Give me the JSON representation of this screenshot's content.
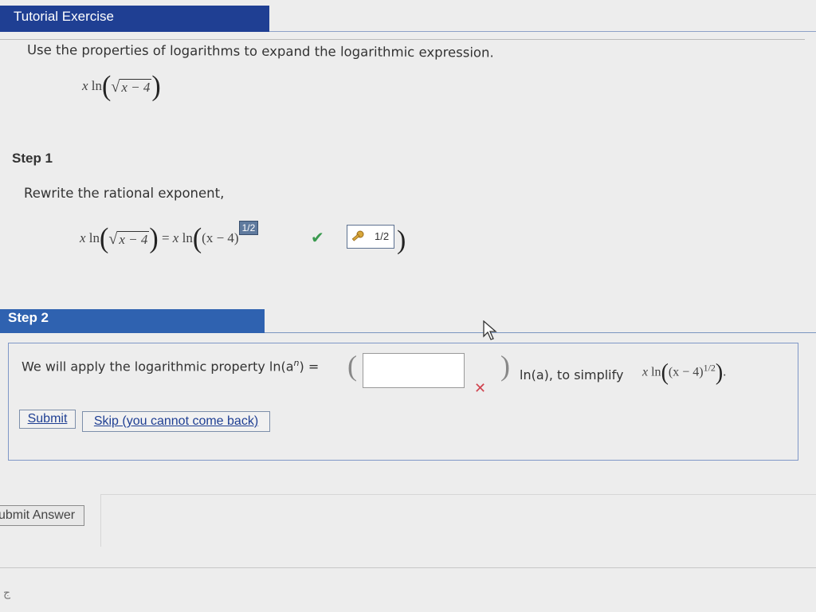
{
  "header": {
    "title": "Tutorial Exercise"
  },
  "problem": {
    "instruction": "Use the properties of logarithms to expand the logarithmic expression.",
    "expression": {
      "coef": "x",
      "fn": "ln",
      "radicand": "x − 4"
    }
  },
  "step1": {
    "label": "Step 1",
    "text": "Rewrite the rational exponent,",
    "lhs": {
      "coef": "x",
      "fn": "ln",
      "radicand": "x − 4"
    },
    "equals": "=",
    "rhs": {
      "coef": "x",
      "fn": "ln",
      "base": "(x − 4)",
      "exponent": "1/2"
    },
    "answer_value": "1/2",
    "status": "correct",
    "icons": {
      "check": "check-icon",
      "key": "key-icon"
    }
  },
  "step2": {
    "label": "Step 2",
    "text_before": "We will apply the logarithmic property ln(a",
    "superscript": "n",
    "text_after_sup": ") =",
    "answer_input": {
      "value": "",
      "placeholder": ""
    },
    "status": "incorrect",
    "text_tail": "ln(a), to simplify",
    "expr": {
      "coef": "x",
      "fn": "ln",
      "base": "(x − 4)",
      "exponent": "1/2",
      "trailing": "."
    },
    "icons": {
      "x": "x-icon"
    }
  },
  "buttons": {
    "submit": "Submit",
    "skip": "Skip (you cannot come back)",
    "submit_answer": "ubmit Answer"
  },
  "colors": {
    "header_bg": "#1f3f93",
    "step2_bg": "#2f62b0",
    "check": "#3a9a4f",
    "x_mark": "#d0444f"
  },
  "footer": {
    "glyph": "ج"
  }
}
